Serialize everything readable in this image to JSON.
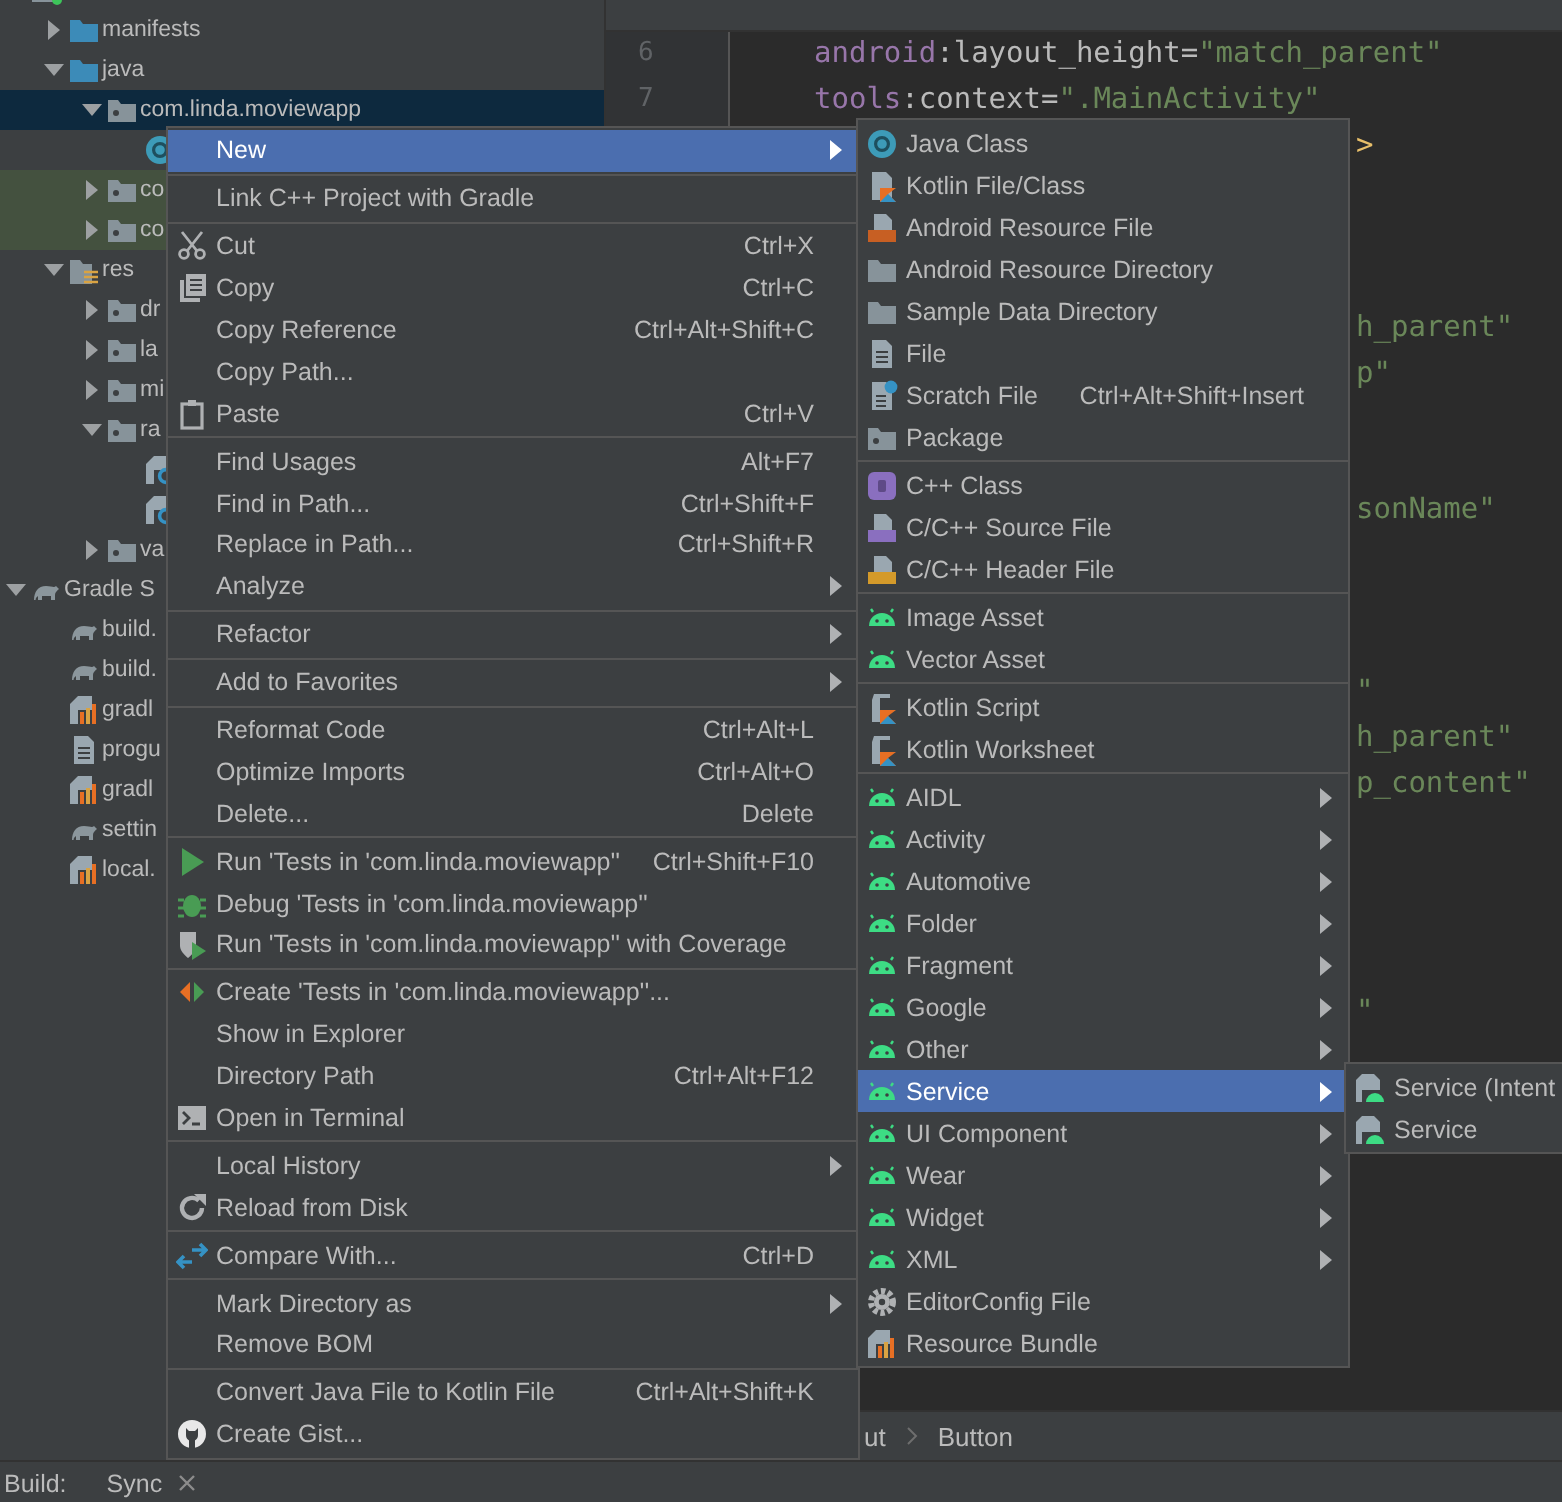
{
  "project_tree": [
    {
      "kind": "module",
      "selected": false,
      "children": [
        {
          "label": "manifests",
          "kind": "src-folder",
          "expanded": false,
          "selected": false
        },
        {
          "label": "java",
          "kind": "src-folder",
          "expanded": true,
          "selected": false,
          "children": [
            {
              "label": "com.linda.moviewapp",
              "kind": "pkg",
              "expanded": true,
              "selected": true,
              "children": [
                {
                  "kind": "class",
                  "selected": false
                }
              ]
            },
            {
              "label": "co",
              "kind": "test-pkg",
              "expanded": false,
              "selected": false
            },
            {
              "label": "co",
              "kind": "test-pkg",
              "expanded": false,
              "selected": false
            }
          ]
        },
        {
          "label": "res",
          "kind": "res",
          "expanded": true,
          "selected": false,
          "children": [
            {
              "label": "dr",
              "kind": "pkg",
              "expanded": false,
              "selected": false
            },
            {
              "label": "la",
              "kind": "pkg",
              "expanded": false,
              "selected": false
            },
            {
              "label": "mi",
              "kind": "pkg",
              "expanded": false,
              "selected": false
            },
            {
              "label": "ra",
              "kind": "pkg",
              "expanded": true,
              "selected": false,
              "children": [
                {
                  "kind": "raw-file",
                  "selected": false
                },
                {
                  "kind": "raw-file",
                  "selected": false
                }
              ]
            },
            {
              "label": "va",
              "kind": "pkg",
              "expanded": false,
              "selected": false
            }
          ]
        }
      ]
    },
    {
      "label": "Gradle S",
      "kind": "gradle",
      "expanded": true,
      "selected": false,
      "children": [
        {
          "label": "build.",
          "kind": "gradle",
          "selected": false
        },
        {
          "label": "build.",
          "kind": "gradle",
          "selected": false
        },
        {
          "label": "gradl",
          "kind": "bundle",
          "selected": false
        },
        {
          "label": "progu",
          "kind": "file",
          "selected": false
        },
        {
          "label": "gradl",
          "kind": "bundle",
          "selected": false
        },
        {
          "label": "settin",
          "kind": "gradle",
          "selected": false
        },
        {
          "label": "local.",
          "kind": "bundle",
          "selected": false
        }
      ]
    }
  ],
  "editor": {
    "line_numbers": [
      "6",
      "7"
    ],
    "lines": [
      {
        "kind": "full",
        "segments": [
          {
            "kind": "ns",
            "text": "android"
          },
          {
            "kind": "attr",
            "text": ":layout_height="
          },
          {
            "kind": "value",
            "text": "\"match_parent\""
          }
        ]
      },
      {
        "kind": "full",
        "segments": [
          {
            "kind": "ns",
            "text": "tools"
          },
          {
            "kind": "attr",
            "text": ":context="
          },
          {
            "kind": "value",
            "text": "\".MainActivity\""
          }
        ]
      },
      {
        "kind": "tail",
        "segments": [
          {
            "kind": "tag",
            "text": ">"
          }
        ]
      },
      {
        "kind": "blank"
      },
      {
        "kind": "blank"
      },
      {
        "kind": "blank"
      },
      {
        "kind": "tail",
        "segments": [
          {
            "kind": "value",
            "text": "h_parent\""
          }
        ]
      },
      {
        "kind": "tail",
        "segments": [
          {
            "kind": "value",
            "text": "p\""
          }
        ]
      },
      {
        "kind": "blank"
      },
      {
        "kind": "blank"
      },
      {
        "kind": "tail",
        "segments": [
          {
            "kind": "value",
            "text": "sonName\""
          }
        ]
      },
      {
        "kind": "blank"
      },
      {
        "kind": "blank"
      },
      {
        "kind": "blank"
      },
      {
        "kind": "tail",
        "segments": [
          {
            "kind": "value",
            "text": "\""
          }
        ]
      },
      {
        "kind": "tail",
        "segments": [
          {
            "kind": "value",
            "text": "h_parent\""
          }
        ]
      },
      {
        "kind": "tail",
        "segments": [
          {
            "kind": "value",
            "text": "p_content\""
          }
        ]
      },
      {
        "kind": "blank"
      },
      {
        "kind": "blank"
      },
      {
        "kind": "blank"
      },
      {
        "kind": "blank"
      },
      {
        "kind": "tail",
        "segments": [
          {
            "kind": "value",
            "text": "\""
          }
        ]
      }
    ]
  },
  "breadcrumb": [
    "ut",
    "Button"
  ],
  "bottom_bar": {
    "label": "Build:",
    "tabs": [
      "Sync"
    ]
  },
  "context_menu": {
    "groups": [
      [
        {
          "label": "New",
          "kind": "plain",
          "submenu": true,
          "selected": true
        }
      ],
      [
        {
          "label": "Link C++ Project with Gradle",
          "kind": "plain",
          "submenu": false,
          "selected": false
        }
      ],
      [
        {
          "label": "Cut",
          "kind": "scissors",
          "shortcut": "Ctrl+X",
          "submenu": false,
          "selected": false
        },
        {
          "label": "Copy",
          "kind": "copy",
          "shortcut": "Ctrl+C",
          "submenu": false,
          "selected": false
        },
        {
          "label": "Copy Reference",
          "kind": "plain",
          "shortcut": "Ctrl+Alt+Shift+C",
          "submenu": false,
          "selected": false
        },
        {
          "label": "Copy Path...",
          "kind": "plain",
          "submenu": false,
          "selected": false
        },
        {
          "label": "Paste",
          "kind": "paste",
          "shortcut": "Ctrl+V",
          "submenu": false,
          "selected": false
        }
      ],
      [
        {
          "label": "Find Usages",
          "kind": "plain",
          "shortcut": "Alt+F7",
          "submenu": false,
          "selected": false
        },
        {
          "label": "Find in Path...",
          "kind": "plain",
          "shortcut": "Ctrl+Shift+F",
          "submenu": false,
          "selected": false
        },
        {
          "label": "Replace in Path...",
          "kind": "plain",
          "shortcut": "Ctrl+Shift+R",
          "submenu": false,
          "selected": false
        },
        {
          "label": "Analyze",
          "kind": "plain",
          "submenu": true,
          "selected": false
        }
      ],
      [
        {
          "label": "Refactor",
          "kind": "plain",
          "submenu": true,
          "selected": false
        }
      ],
      [
        {
          "label": "Add to Favorites",
          "kind": "plain",
          "submenu": true,
          "selected": false
        }
      ],
      [
        {
          "label": "Reformat Code",
          "kind": "plain",
          "shortcut": "Ctrl+Alt+L",
          "submenu": false,
          "selected": false
        },
        {
          "label": "Optimize Imports",
          "kind": "plain",
          "shortcut": "Ctrl+Alt+O",
          "submenu": false,
          "selected": false
        },
        {
          "label": "Delete...",
          "kind": "plain",
          "shortcut": "Delete",
          "submenu": false,
          "selected": false
        }
      ],
      [
        {
          "label": "Run 'Tests in 'com.linda.moviewapp''",
          "kind": "run",
          "shortcut": "Ctrl+Shift+F10",
          "submenu": false,
          "selected": false
        },
        {
          "label": "Debug 'Tests in 'com.linda.moviewapp''",
          "kind": "debug",
          "submenu": false,
          "selected": false
        },
        {
          "label": "Run 'Tests in 'com.linda.moviewapp'' with Coverage",
          "kind": "coverage",
          "submenu": false,
          "selected": false
        }
      ],
      [
        {
          "label": "Create 'Tests in 'com.linda.moviewapp''...",
          "kind": "create-test",
          "submenu": false,
          "selected": false
        },
        {
          "label": "Show in Explorer",
          "kind": "plain",
          "submenu": false,
          "selected": false
        },
        {
          "label": "Directory Path",
          "kind": "plain",
          "shortcut": "Ctrl+Alt+F12",
          "submenu": false,
          "selected": false
        },
        {
          "label": "Open in Terminal",
          "kind": "terminal",
          "submenu": false,
          "selected": false
        }
      ],
      [
        {
          "label": "Local History",
          "kind": "plain",
          "submenu": true,
          "selected": false
        },
        {
          "label": "Reload from Disk",
          "kind": "reload",
          "submenu": false,
          "selected": false
        }
      ],
      [
        {
          "label": "Compare With...",
          "kind": "compare",
          "shortcut": "Ctrl+D",
          "submenu": false,
          "selected": false
        }
      ],
      [
        {
          "label": "Mark Directory as",
          "kind": "plain",
          "submenu": true,
          "selected": false
        },
        {
          "label": "Remove BOM",
          "kind": "plain",
          "submenu": false,
          "selected": false
        }
      ],
      [
        {
          "label": "Convert Java File to Kotlin File",
          "kind": "plain",
          "shortcut": "Ctrl+Alt+Shift+K",
          "submenu": false,
          "selected": false
        },
        {
          "label": "Create Gist...",
          "kind": "github",
          "submenu": false,
          "selected": false
        }
      ]
    ]
  },
  "new_submenu": {
    "groups": [
      [
        {
          "label": "Java Class",
          "kind": "java-class",
          "submenu": false,
          "selected": false
        },
        {
          "label": "Kotlin File/Class",
          "kind": "kotlin-file",
          "submenu": false,
          "selected": false
        },
        {
          "label": "Android Resource File",
          "kind": "res-file",
          "submenu": false,
          "selected": false
        },
        {
          "label": "Android Resource Directory",
          "kind": "folder",
          "submenu": false,
          "selected": false
        },
        {
          "label": "Sample Data Directory",
          "kind": "folder",
          "submenu": false,
          "selected": false
        },
        {
          "label": "File",
          "kind": "file",
          "submenu": false,
          "selected": false
        },
        {
          "label": "Scratch File",
          "kind": "scratch",
          "shortcut": "Ctrl+Alt+Shift+Insert",
          "submenu": false,
          "selected": false
        },
        {
          "label": "Package",
          "kind": "pkg",
          "submenu": false,
          "selected": false
        }
      ],
      [
        {
          "label": "C++ Class",
          "kind": "cpp-class",
          "submenu": false,
          "selected": false
        },
        {
          "label": "C/C++ Source File",
          "kind": "cpp-source",
          "submenu": false,
          "selected": false
        },
        {
          "label": "C/C++ Header File",
          "kind": "cpp-header",
          "submenu": false,
          "selected": false
        }
      ],
      [
        {
          "label": "Image Asset",
          "kind": "android",
          "submenu": false,
          "selected": false
        },
        {
          "label": "Vector Asset",
          "kind": "android",
          "submenu": false,
          "selected": false
        }
      ],
      [
        {
          "label": "Kotlin Script",
          "kind": "kotlin-script",
          "submenu": false,
          "selected": false
        },
        {
          "label": "Kotlin Worksheet",
          "kind": "kotlin-script",
          "submenu": false,
          "selected": false
        }
      ],
      [
        {
          "label": "AIDL",
          "kind": "android",
          "submenu": true,
          "selected": false
        },
        {
          "label": "Activity",
          "kind": "android",
          "submenu": true,
          "selected": false
        },
        {
          "label": "Automotive",
          "kind": "android",
          "submenu": true,
          "selected": false
        },
        {
          "label": "Folder",
          "kind": "android",
          "submenu": true,
          "selected": false
        },
        {
          "label": "Fragment",
          "kind": "android",
          "submenu": true,
          "selected": false
        },
        {
          "label": "Google",
          "kind": "android",
          "submenu": true,
          "selected": false
        },
        {
          "label": "Other",
          "kind": "android",
          "submenu": true,
          "selected": false
        },
        {
          "label": "Service",
          "kind": "android",
          "submenu": true,
          "selected": true
        },
        {
          "label": "UI Component",
          "kind": "android",
          "submenu": true,
          "selected": false
        },
        {
          "label": "Wear",
          "kind": "android",
          "submenu": true,
          "selected": false
        },
        {
          "label": "Widget",
          "kind": "android",
          "submenu": true,
          "selected": false
        },
        {
          "label": "XML",
          "kind": "android",
          "submenu": true,
          "selected": false
        },
        {
          "label": "EditorConfig File",
          "kind": "gear",
          "submenu": false,
          "selected": false
        },
        {
          "label": "Resource Bundle",
          "kind": "bundle",
          "submenu": false,
          "selected": false
        }
      ]
    ]
  },
  "service_submenu": {
    "groups": [
      [
        {
          "label": "Service (Intent",
          "kind": "service-file",
          "selected": false
        },
        {
          "label": "Service",
          "kind": "service-file",
          "selected": false
        }
      ]
    ]
  }
}
